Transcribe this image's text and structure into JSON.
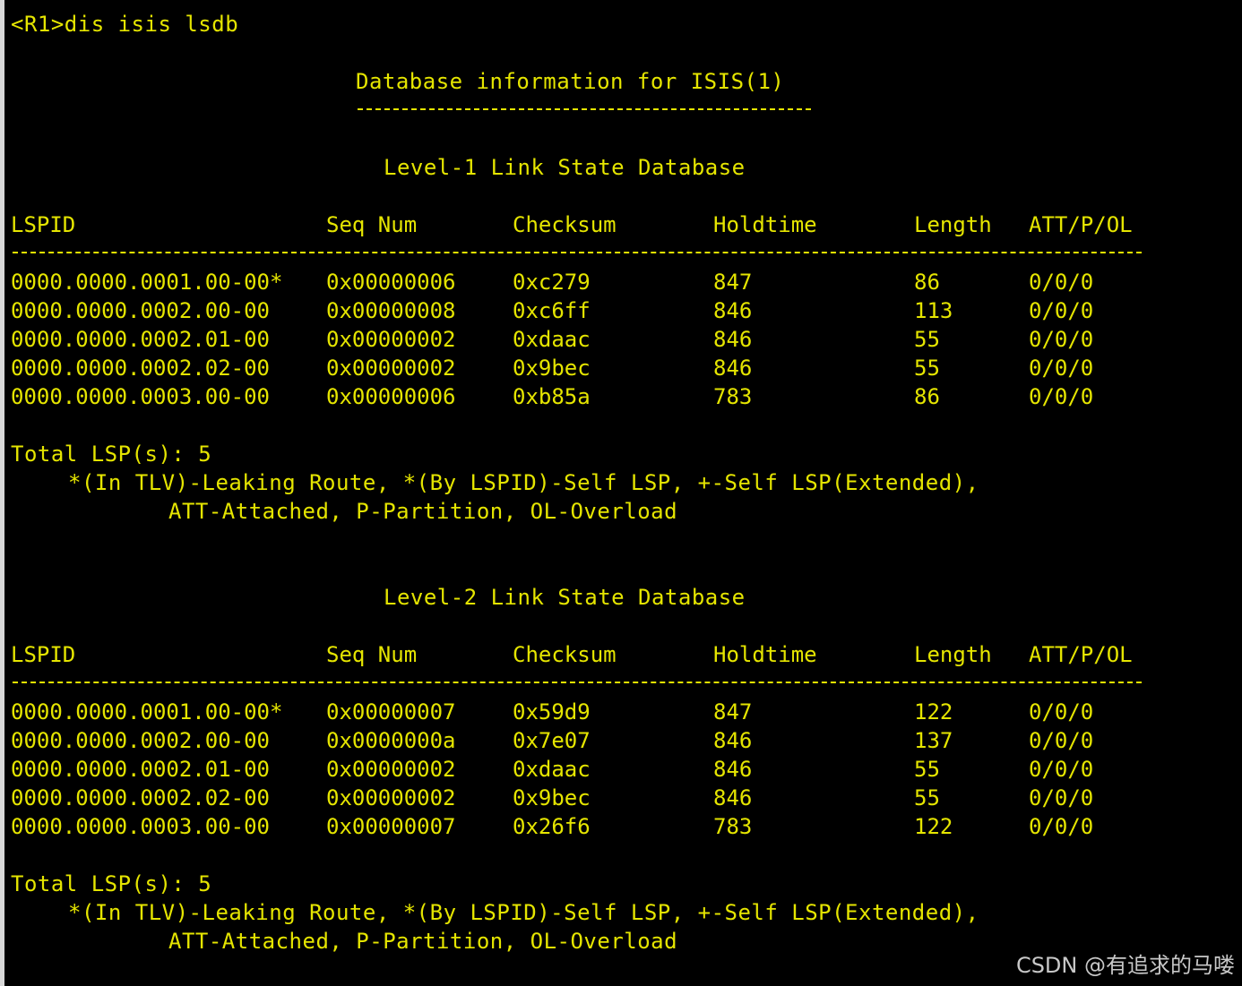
{
  "terminal": {
    "command": "<R1>dis isis lsdb",
    "title": "Database information for ISIS(1)",
    "title_rule": "---------------------------------",
    "headers": [
      "LSPID",
      "Seq Num",
      "Checksum",
      "Holdtime",
      "Length",
      "ATT/P/OL"
    ],
    "level1": {
      "title": "Level-1 Link State Database",
      "rows": [
        [
          "0000.0000.0001.00-00*",
          "0x00000006",
          "0xc279",
          "847",
          "86",
          "0/0/0"
        ],
        [
          "0000.0000.0002.00-00",
          "0x00000008",
          "0xc6ff",
          "846",
          "113",
          "0/0/0"
        ],
        [
          "0000.0000.0002.01-00",
          "0x00000002",
          "0xdaac",
          "846",
          "55",
          "0/0/0"
        ],
        [
          "0000.0000.0002.02-00",
          "0x00000002",
          "0x9bec",
          "846",
          "55",
          "0/0/0"
        ],
        [
          "0000.0000.0003.00-00",
          "0x00000006",
          "0xb85a",
          "783",
          "86",
          "0/0/0"
        ]
      ],
      "total": "Total LSP(s): 5",
      "legend1": "*(In TLV)-Leaking Route, *(By LSPID)-Self LSP, +-Self LSP(Extended),",
      "legend2": "ATT-Attached, P-Partition, OL-Overload"
    },
    "level2": {
      "title": "Level-2 Link State Database",
      "rows": [
        [
          "0000.0000.0001.00-00*",
          "0x00000007",
          "0x59d9",
          "847",
          "122",
          "0/0/0"
        ],
        [
          "0000.0000.0002.00-00",
          "0x0000000a",
          "0x7e07",
          "846",
          "137",
          "0/0/0"
        ],
        [
          "0000.0000.0002.01-00",
          "0x00000002",
          "0xdaac",
          "846",
          "55",
          "0/0/0"
        ],
        [
          "0000.0000.0002.02-00",
          "0x00000002",
          "0x9bec",
          "846",
          "55",
          "0/0/0"
        ],
        [
          "0000.0000.0003.00-00",
          "0x00000007",
          "0x26f6",
          "783",
          "122",
          "0/0/0"
        ]
      ],
      "total": "Total LSP(s): 5",
      "legend1": "*(In TLV)-Leaking Route, *(By LSPID)-Self LSP, +-Self LSP(Extended),",
      "legend2": "ATT-Attached, P-Partition, OL-Overload"
    }
  },
  "watermark": "CSDN @有追求的马喽",
  "colors": {
    "background": "#000000",
    "text": "#e5e500",
    "watermark": "#c8c8c8"
  }
}
